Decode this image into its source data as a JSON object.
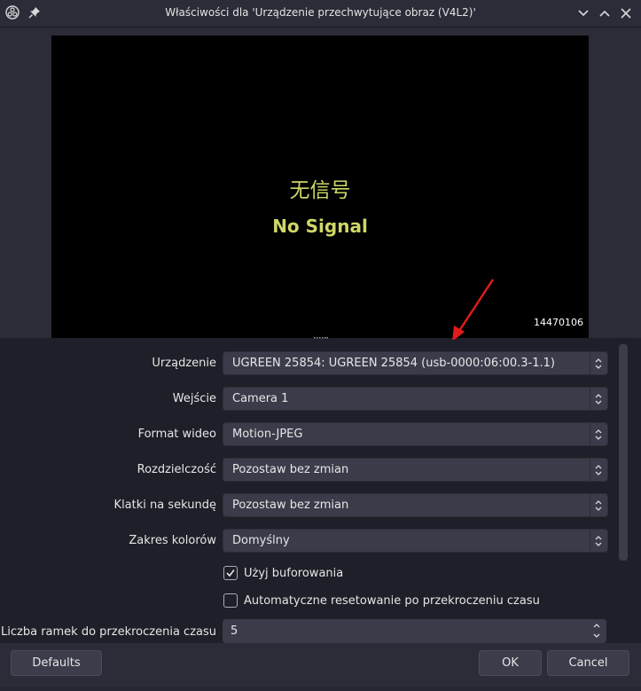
{
  "window": {
    "title": "Właściwości dla 'Urządzenie przechwytujące obraz (V4L2)'",
    "icons": [
      "obs-icon",
      "pin-icon",
      "chevron-down-icon",
      "chevron-up-icon",
      "close-icon"
    ]
  },
  "preview": {
    "chinese_text": "无信号",
    "english_text": "No Signal",
    "serial": "14470106",
    "annotation_color": "#e01b1b",
    "text_color": "#cfd766"
  },
  "properties": {
    "device": {
      "label": "Urządzenie",
      "value": "UGREEN 25854: UGREEN 25854 (usb-0000:06:00.3-1.1)"
    },
    "input": {
      "label": "Wejście",
      "value": "Camera 1"
    },
    "video_format": {
      "label": "Format wideo",
      "value": "Motion-JPEG"
    },
    "resolution": {
      "label": "Rozdzielczość",
      "value": "Pozostaw bez zmian"
    },
    "framerate": {
      "label": "Klatki na sekundę",
      "value": "Pozostaw bez zmian"
    },
    "color_range": {
      "label": "Zakres kolorów",
      "value": "Domyślny"
    },
    "buffering": {
      "label": "Użyj buforowania",
      "checked": true
    },
    "auto_reset": {
      "label": "Automatyczne resetowanie po przekroczeniu czasu",
      "checked": false
    },
    "timeout_frames": {
      "label": "Liczba ramek do przekroczenia czasu",
      "value": "5"
    }
  },
  "buttons": {
    "defaults": "Defaults",
    "ok": "OK",
    "cancel": "Cancel"
  },
  "colors": {
    "background": "#1e1f28",
    "panel": "#2b2c38",
    "control": "#3a3c4a"
  }
}
